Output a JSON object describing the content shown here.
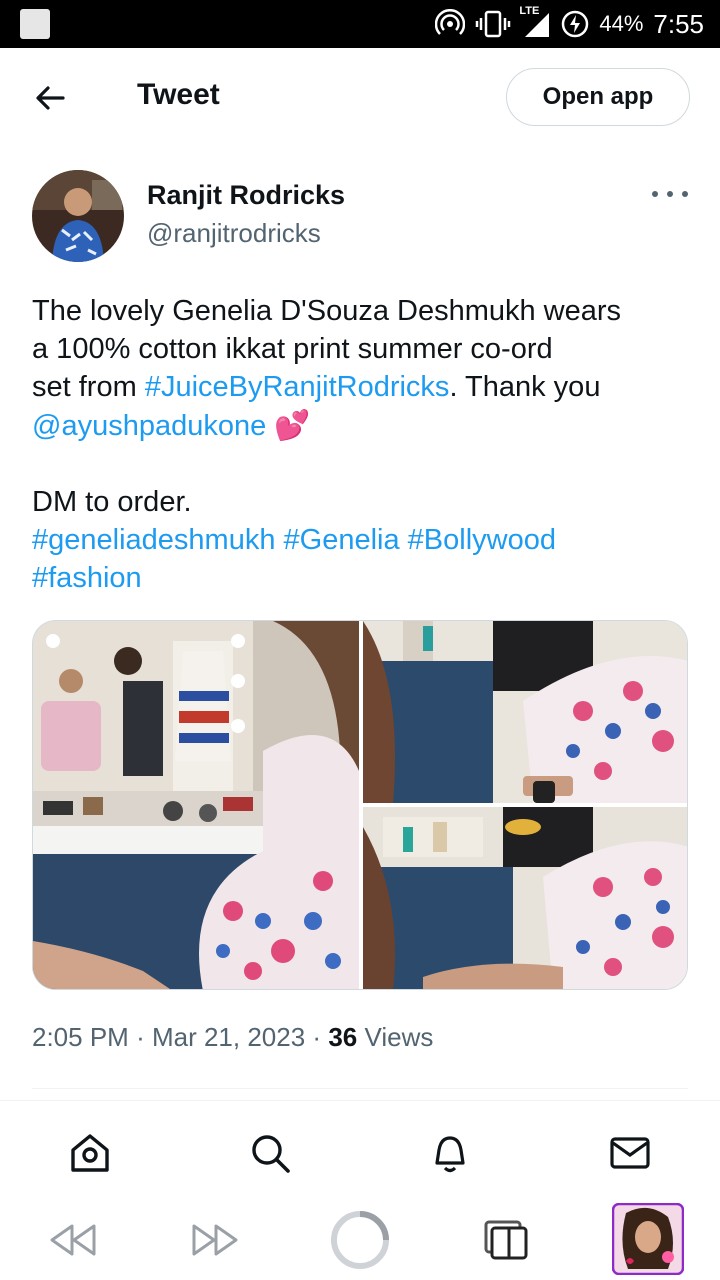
{
  "status_bar": {
    "network": "LTE",
    "battery": "44%",
    "time": "7:55"
  },
  "header": {
    "title": "Tweet",
    "open_app_label": "Open app"
  },
  "author": {
    "name": "Ranjit Rodricks",
    "handle": "@ranjitrodricks"
  },
  "tweet": {
    "line1": "The lovely Genelia D'Souza Deshmukh wears",
    "line2": "a 100% cotton ikkat print summer co-ord",
    "line3_pre": "set from ",
    "line3_hashtag": "#JuiceByRanjitRodricks",
    "line3_post": ". Thank you",
    "mention": "@ayushpadukone",
    "emoji": "💕",
    "dm_line": "DM to order.",
    "hashtags_line1": "#geneliadeshmukh #Genelia #Bollywood",
    "hashtags_line2": "#fashion"
  },
  "meta": {
    "time": "2:05 PM",
    "sep": "·",
    "date": "Mar 21, 2023",
    "views_count": "36",
    "views_label": "Views"
  },
  "tabs": {
    "home": "home-icon",
    "search": "search-icon",
    "notifications": "bell-icon",
    "messages": "mail-icon"
  },
  "colors": {
    "link": "#1d9bf0",
    "text": "#0f1419",
    "secondary": "#536471",
    "border": "#cfd9de"
  }
}
